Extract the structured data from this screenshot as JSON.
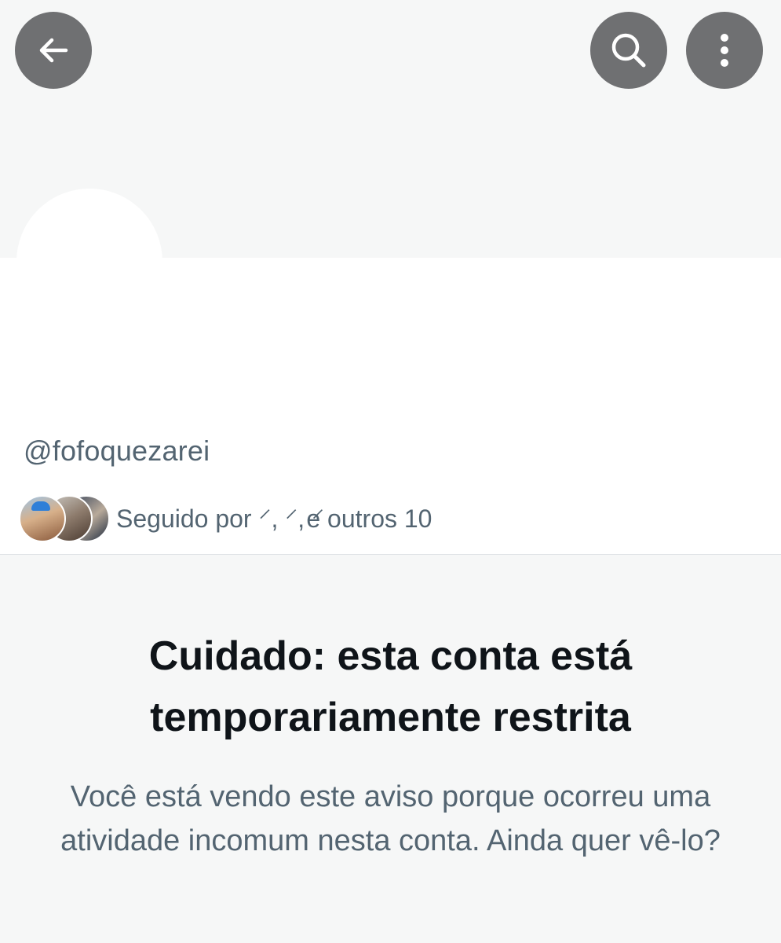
{
  "header": {
    "back_icon": "arrow-left-icon",
    "search_icon": "search-icon",
    "more_icon": "more-vertical-icon",
    "button_color": "#6f7072",
    "banner_color": "#f6f7f7"
  },
  "profile": {
    "handle": "@fofoquezarei",
    "followed_by_prefix": "Seguido por",
    "followed_by_names": "⸍, ⸍, ⸍",
    "followed_by_suffix": "e outros 10"
  },
  "warning": {
    "title": "Cuidado: esta conta está temporariamente restrita",
    "body": "Você está vendo este aviso porque ocorreu uma atividade incomum nesta conta. Ainda quer vê-lo?"
  }
}
